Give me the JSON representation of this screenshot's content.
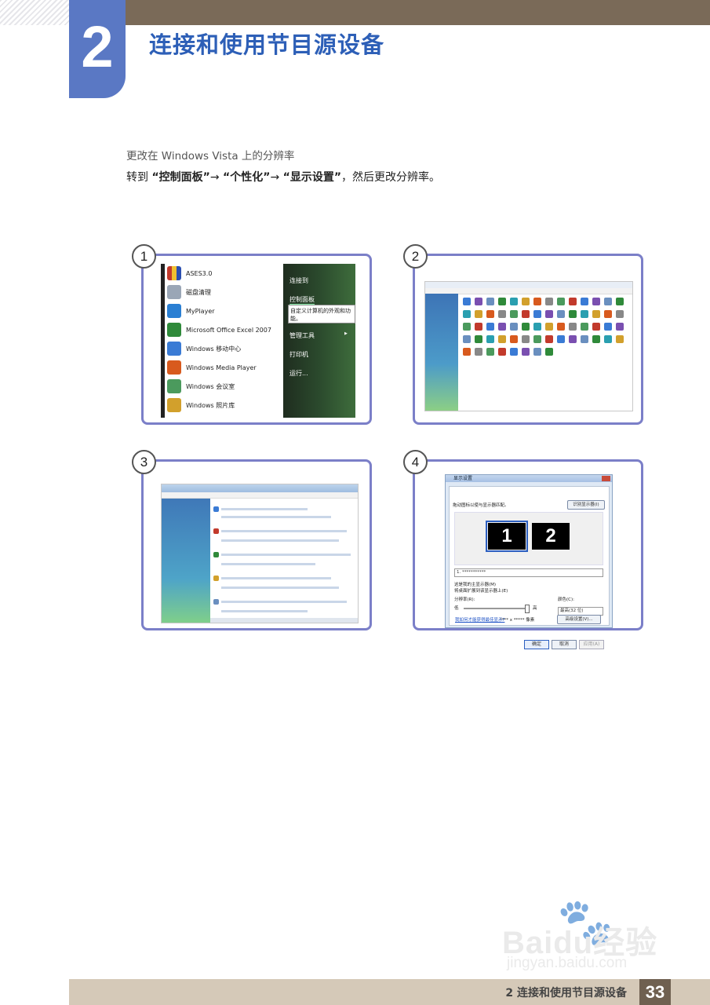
{
  "header": {
    "chapter_number": "2",
    "chapter_title": "连接和使用节目源设备"
  },
  "intro": {
    "subtitle": "更改在 Windows Vista 上的分辨率",
    "instruction_prefix": "转到 ",
    "step1": "“控制面板”",
    "arrow1": "→ ",
    "step2": "“个性化”",
    "arrow2": "→ ",
    "step3": "“显示设置”",
    "instruction_suffix": "，然后更改分辨率。"
  },
  "steps": [
    {
      "number": "1"
    },
    {
      "number": "2"
    },
    {
      "number": "3"
    },
    {
      "number": "4"
    }
  ],
  "screenshot1": {
    "left_items": [
      "ASES3.0",
      "磁盘清理",
      "MyPlayer",
      "Microsoft Office Excel 2007",
      "Windows 移动中心",
      "Windows Media Player",
      "Windows 会议室",
      "Windows 照片库"
    ],
    "right_items": [
      "连接到",
      "控制面板",
      "管理工具",
      "打印机",
      "运行..."
    ],
    "tooltip": "自定义计算机的外观和功能。",
    "submenu_arrow": "▶",
    "icon_colors": [
      "#c23a2c",
      "#6a8fbf",
      "#2a7fd3",
      "#2f8a3a",
      "#3a7bd5",
      "#d85a1e",
      "#4b9a5d",
      "#d2a02c"
    ]
  },
  "screenshot4": {
    "window_title": "显示设置",
    "tab": "显示器",
    "drag_hint": "拖动图标以使与显示器匹配。",
    "identify_button": "识别显示器(I)",
    "monitor_1": "1",
    "monitor_2": "2",
    "selected_display": "1. ***********",
    "primary_checkbox": "这是我的主显示器(M)",
    "extend_checkbox": "将桌面扩展到该显示器上(E)",
    "resolution_label": "分辨率(R):",
    "low": "低",
    "high": "高",
    "colors_label": "颜色(C):",
    "colors_value": "最高(32 位)",
    "resolution_value": "**** x ***** 像素",
    "help_link": "我如何才能获得最佳显示?",
    "advanced_button": "高级设置(V)...",
    "ok_button": "确定",
    "cancel_button": "取消",
    "apply_button": "应用(A)"
  },
  "footer": {
    "chapter_text": "2 连接和使用节目源设备",
    "page_number": "33"
  },
  "watermark": {
    "brand": "Baidu经验",
    "url": "jingyan.baidu.com"
  },
  "colors": {
    "title_blue": "#2d5fb7",
    "chapter_block": "#5a78c4",
    "frame_border": "#7b7fc8",
    "top_bar": "#7a6a58",
    "footer_bar": "#d5c9b8"
  }
}
